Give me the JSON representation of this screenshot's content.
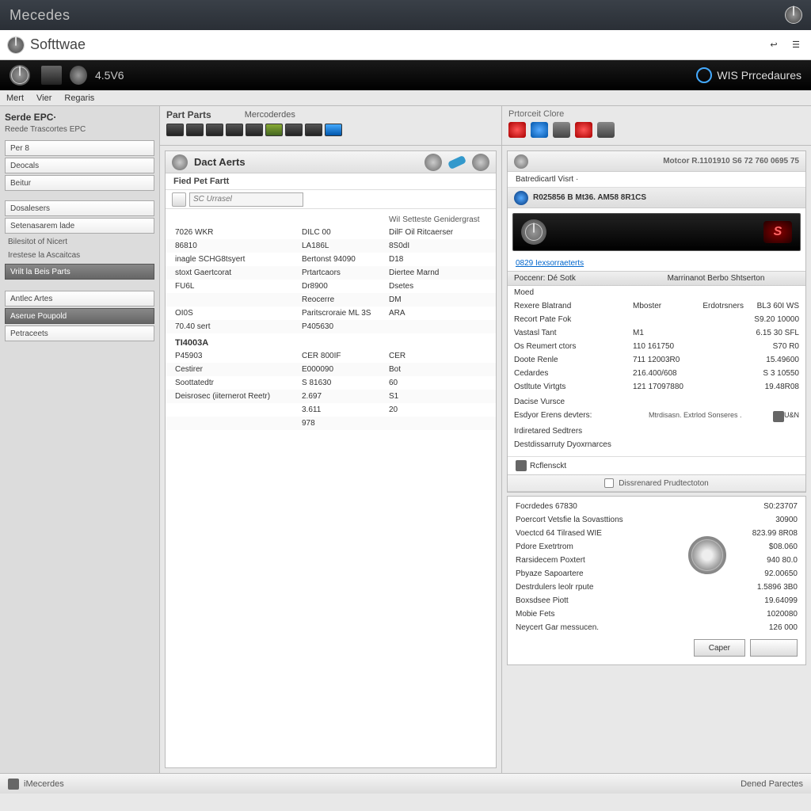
{
  "titlebar": {
    "title": "Mecedes"
  },
  "subhead": {
    "label": "Softtwae"
  },
  "blackbar": {
    "engine": "4.5V6",
    "wis": "WIS Prrcedaures"
  },
  "menu": {
    "m1": "Mert",
    "m2": "Vier",
    "m3": "Regaris"
  },
  "sidebar": {
    "title": "Serde EPC·",
    "sub": "Reede Trascortes EPC",
    "items": [
      "Per 8",
      "Deocals",
      "Beitur",
      "Dosalesers",
      "Setenasarem lade",
      "Bilesitot of Nicert",
      "Irestese la Ascaitcas",
      "Vrilt la Beis Parts",
      "Antlec Artes",
      "Aserue Poupold",
      "Petraceets"
    ]
  },
  "center": {
    "tab1": "Part Parts",
    "tab2": "Mercoderdes",
    "panelTitle": "Dact Aerts",
    "sub": "Fied Pet Fartt",
    "search": "SC Urrasel",
    "gridHead": {
      "c2": "WiI Setteste Genidergrast"
    },
    "rows": [
      {
        "a": "7026 WKR",
        "b": "DILC 00",
        "c": "DilF Oil Ritcaerser"
      },
      {
        "a": "86810",
        "b": "LA186L",
        "c": "8S0dI"
      },
      {
        "a": "inagle SCHG8tsyert",
        "b": "Bertonst 94090",
        "c": "D18"
      },
      {
        "a": "stoxt Gaertcorat",
        "b": "Prtartcaors",
        "c": "Diertee Marnd"
      },
      {
        "a": "FU6L",
        "b": "Dr8900",
        "c": "Dsetes"
      },
      {
        "a": "",
        "b": "Reocerre",
        "c": "DM"
      },
      {
        "a": "OI0S",
        "b": "Paritscroraie ML 3S",
        "c": "ARA"
      },
      {
        "a": "70.40 sert",
        "b": "P405630",
        "c": ""
      }
    ],
    "sectionB": "TI4003A",
    "rowsB": [
      {
        "a": "P45903",
        "b": "CER 800IF",
        "c": "CER"
      },
      {
        "a": "Cestirer",
        "b": "E000090",
        "c": "Bot"
      },
      {
        "a": "Soottatedtr",
        "b": "S 81630",
        "c": "60"
      },
      {
        "a": "Deisrosec (iiternerot Reetr)",
        "b": "2.697",
        "c": "S1"
      },
      {
        "a": "",
        "b": "3.611",
        "c": "20"
      },
      {
        "a": "",
        "b": "978",
        "c": ""
      }
    ]
  },
  "right": {
    "headTitle": "Prtorceit Clore",
    "vin": "Motcor R.1101910 S6 72 760 0695 75",
    "sub": "Batredicartl   Visrt ·",
    "bannerTitle": "R025856 B Mt36. AM58 8R1CS",
    "link": "0829 Iexsorraeterts",
    "th": {
      "a": "Poccenr: Dé Sotk",
      "b": "Marrinanot Berbo Shtserton"
    },
    "trows": [
      {
        "a": "Moed",
        "b": "",
        "c": "",
        "d": ""
      },
      {
        "a": "Rexere Blatrand",
        "b": "Mboster",
        "c": "Erdotrsners",
        "d": "BL3 60I WS"
      },
      {
        "a": "Recort Pate Fok",
        "b": "",
        "c": "",
        "d": "S9.20 10000"
      },
      {
        "a": "Vastasl Tant",
        "b": "M1",
        "c": "",
        "d": "6.15 30 SFL"
      },
      {
        "a": "Os Reumert ctors",
        "b": "110 161750",
        "c": "",
        "d": "S70 R0"
      },
      {
        "a": "Doote Renle",
        "b": "711 12003R0",
        "c": "",
        "d": "15.49600"
      },
      {
        "a": "Cedardes",
        "b": "216.400/608",
        "c": "",
        "d": "S 3 10550"
      },
      {
        "a": "Ostltute Virtgts",
        "b": "121 17097880",
        "c": "",
        "d": "19.48R08"
      }
    ],
    "subrows": [
      {
        "a": "Dacise Vursce",
        "b": ""
      },
      {
        "a": "  Esdyor Erens devters:",
        "b": "Mtrdisasn. Extrlod Sonseres ."
      },
      {
        "a": "Irdiretared Sedtrers",
        "b": ""
      },
      {
        "a": "Destdissarruty Dyoxrnarces",
        "b": ""
      }
    ],
    "refLabel": "Rcflensckt",
    "chkLabel": "Dissrenared Prudtectoton",
    "brows": [
      {
        "a": "Focrdedes    67830",
        "b": "S0:23707"
      },
      {
        "a": "Poercort Vetsfie la Sovasttions",
        "b": "30900"
      },
      {
        "a": "Voectcd 64 Tilrased WIE",
        "b": "823.99 8R08"
      },
      {
        "a": "Pdore      Exetrtrom",
        "b": "$08.060"
      },
      {
        "a": "Rarsidecem Poxtert",
        "b": "940 80.0"
      },
      {
        "a": "Pbyaze Sapoartere",
        "b": "92.00650"
      },
      {
        "a": "Destrdulers leolr rpute",
        "b": "1.5896 3B0"
      },
      {
        "a": "Boxsdsee Piott",
        "b": "19.64099"
      },
      {
        "a": "Mobie Fets",
        "b": "1020080"
      },
      {
        "a": "Neycert Gar messucen.",
        "b": "126 000"
      }
    ],
    "btn1": "Caper",
    "btn2": ""
  },
  "footer": {
    "l": "iMecerdes",
    "r": "Dened Parectes"
  }
}
